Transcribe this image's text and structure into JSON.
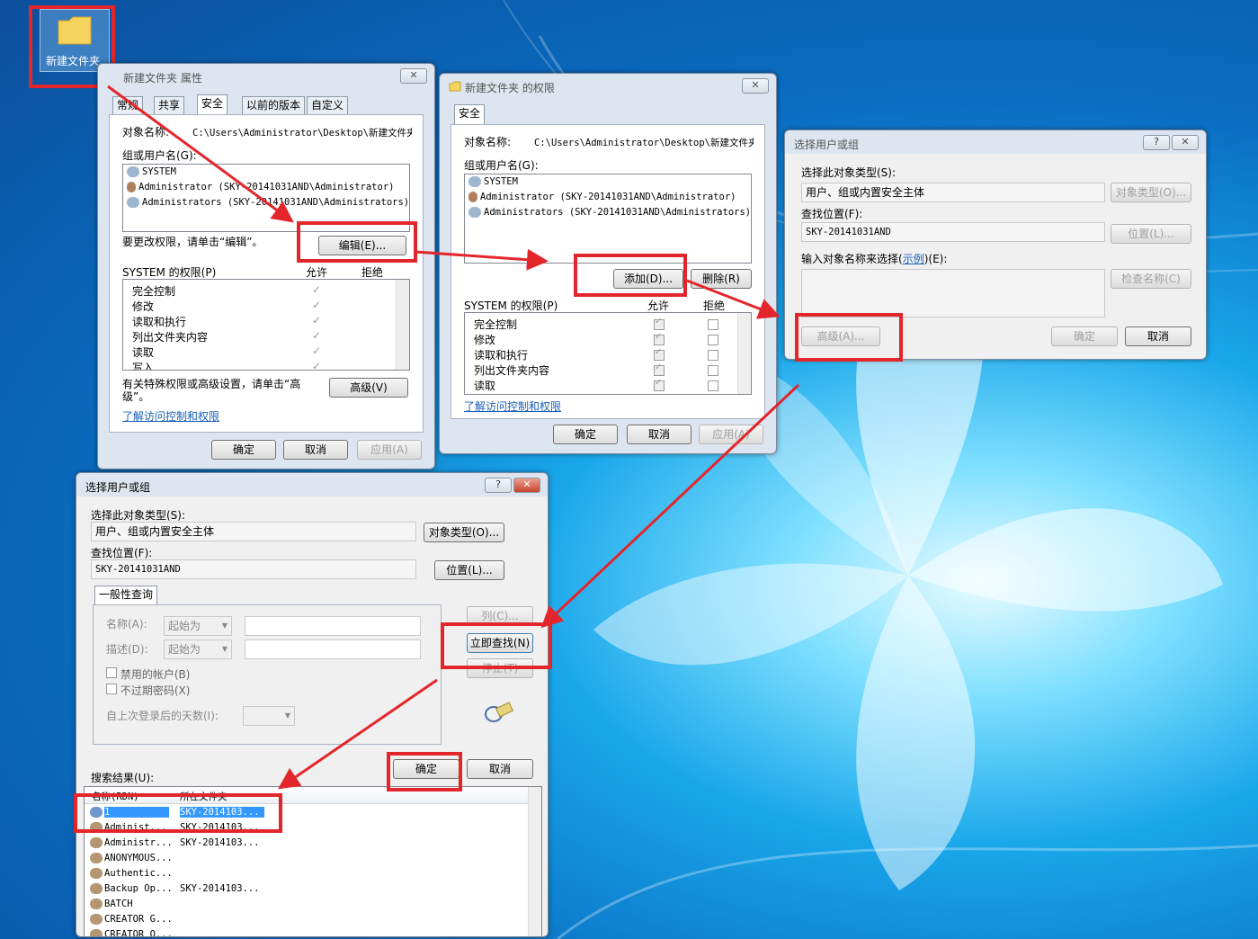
{
  "desktop": {
    "folder_label": "新建文件夹"
  },
  "win1": {
    "title": "新建文件夹 属性",
    "tabs": [
      "常规",
      "共享",
      "安全",
      "以前的版本",
      "自定义"
    ],
    "object_label": "对象名称:",
    "object_value": "C:\\Users\\Administrator\\Desktop\\新建文件夹",
    "group_label": "组或用户名(G):",
    "users": [
      "SYSTEM",
      "Administrator (SKY-20141031AND\\Administrator)",
      "Administrators (SKY-20141031AND\\Administrators)"
    ],
    "change_text": "要更改权限，请单击“编辑”。",
    "edit_btn": "编辑(E)...",
    "perm_label": "SYSTEM 的权限(P)",
    "allow": "允许",
    "deny": "拒绝",
    "perms": [
      "完全控制",
      "修改",
      "读取和执行",
      "列出文件夹内容",
      "读取",
      "写入"
    ],
    "special_text_1": "有关特殊权限或高级设置，请单击“高",
    "special_text_2": "级”。",
    "advanced_btn": "高级(V)",
    "learn_link": "了解访问控制和权限",
    "ok": "确定",
    "cancel": "取消",
    "apply": "应用(A)"
  },
  "win2": {
    "title": "新建文件夹 的权限",
    "tab": "安全",
    "object_label": "对象名称:",
    "object_value": "C:\\Users\\Administrator\\Desktop\\新建文件夹",
    "group_label": "组或用户名(G):",
    "users": [
      "SYSTEM",
      "Administrator (SKY-20141031AND\\Administrator)",
      "Administrators (SKY-20141031AND\\Administrators)"
    ],
    "add_btn": "添加(D)...",
    "remove_btn": "删除(R)",
    "perm_label": "SYSTEM 的权限(P)",
    "allow": "允许",
    "deny": "拒绝",
    "perms": [
      "完全控制",
      "修改",
      "读取和执行",
      "列出文件夹内容",
      "读取"
    ],
    "learn_link": "了解访问控制和权限",
    "ok": "确定",
    "cancel": "取消",
    "apply": "应用(A)"
  },
  "win3": {
    "title": "选择用户或组",
    "help": "?",
    "type_label": "选择此对象类型(S):",
    "type_value": "用户、组或内置安全主体",
    "type_btn": "对象类型(O)...",
    "loc_label": "查找位置(F):",
    "loc_value": "SKY-20141031AND",
    "loc_btn": "位置(L)...",
    "enter_label_pre": "输入对象名称来选择(",
    "enter_label_link": "示例",
    "enter_label_post": ")(E):",
    "check_btn": "检查名称(C)",
    "advanced_btn": "高级(A)...",
    "ok": "确定",
    "cancel": "取消"
  },
  "win4": {
    "title": "选择用户或组",
    "help": "?",
    "type_label": "选择此对象类型(S):",
    "type_value": "用户、组或内置安全主体",
    "type_btn": "对象类型(O)...",
    "loc_label": "查找位置(F):",
    "loc_value": "SKY-20141031AND",
    "loc_btn": "位置(L)...",
    "query_tab": "一般性查询",
    "name_label": "名称(A):",
    "desc_label": "描述(D):",
    "starts_with": "起始为",
    "disabled_accounts": "禁用的帐户(B)",
    "no_expire": "不过期密码(X)",
    "days_label": "自上次登录后的天数(I):",
    "columns_btn": "列(C)...",
    "find_now_btn": "立即查找(N)",
    "stop_btn": "停止(T)",
    "ok": "确定",
    "cancel": "取消",
    "results_label": "搜索结果(U):",
    "col_name": "名称(RDN)",
    "col_folder": "所在文件夹",
    "rows": [
      {
        "name": "1",
        "folder": "SKY-2014103..."
      },
      {
        "name": "Administ...",
        "folder": "SKY-2014103..."
      },
      {
        "name": "Administr...",
        "folder": "SKY-2014103..."
      },
      {
        "name": "ANONYMOUS...",
        "folder": ""
      },
      {
        "name": "Authentic...",
        "folder": ""
      },
      {
        "name": "Backup Op...",
        "folder": "SKY-2014103..."
      },
      {
        "name": "BATCH",
        "folder": ""
      },
      {
        "name": "CREATOR G...",
        "folder": ""
      },
      {
        "name": "CREATOR O...",
        "folder": ""
      }
    ]
  },
  "colors": {
    "accent_red": "#e3262b",
    "select_blue": "#3399ff",
    "link_blue": "#1a5fb4"
  }
}
